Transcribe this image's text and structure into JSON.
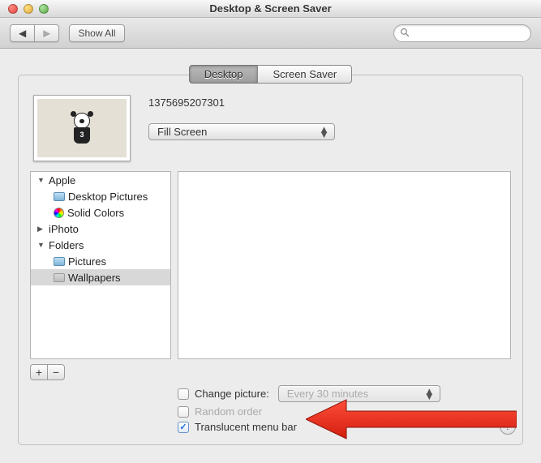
{
  "window": {
    "title": "Desktop & Screen Saver"
  },
  "toolbar": {
    "back_label": "◀",
    "forward_label": "▶",
    "showall_label": "Show All",
    "search_placeholder": ""
  },
  "tabs": {
    "desktop": "Desktop",
    "screensaver": "Screen Saver",
    "active": "desktop"
  },
  "wallpaper": {
    "name": "1375695207301",
    "fit_mode": "Fill Screen"
  },
  "sources": {
    "apple": {
      "label": "Apple",
      "desktop_pictures": "Desktop Pictures",
      "solid_colors": "Solid Colors"
    },
    "iphoto": {
      "label": "iPhoto"
    },
    "folders": {
      "label": "Folders",
      "pictures": "Pictures",
      "wallpapers": "Wallpapers"
    },
    "selected": "wallpapers"
  },
  "buttons": {
    "add": "+",
    "remove": "−"
  },
  "options": {
    "change_picture_label": "Change picture:",
    "change_interval": "Every 30 minutes",
    "random_label": "Random order",
    "translucent_label": "Translucent menu bar",
    "change_checked": false,
    "random_checked": false,
    "translucent_checked": true
  },
  "help": "?"
}
